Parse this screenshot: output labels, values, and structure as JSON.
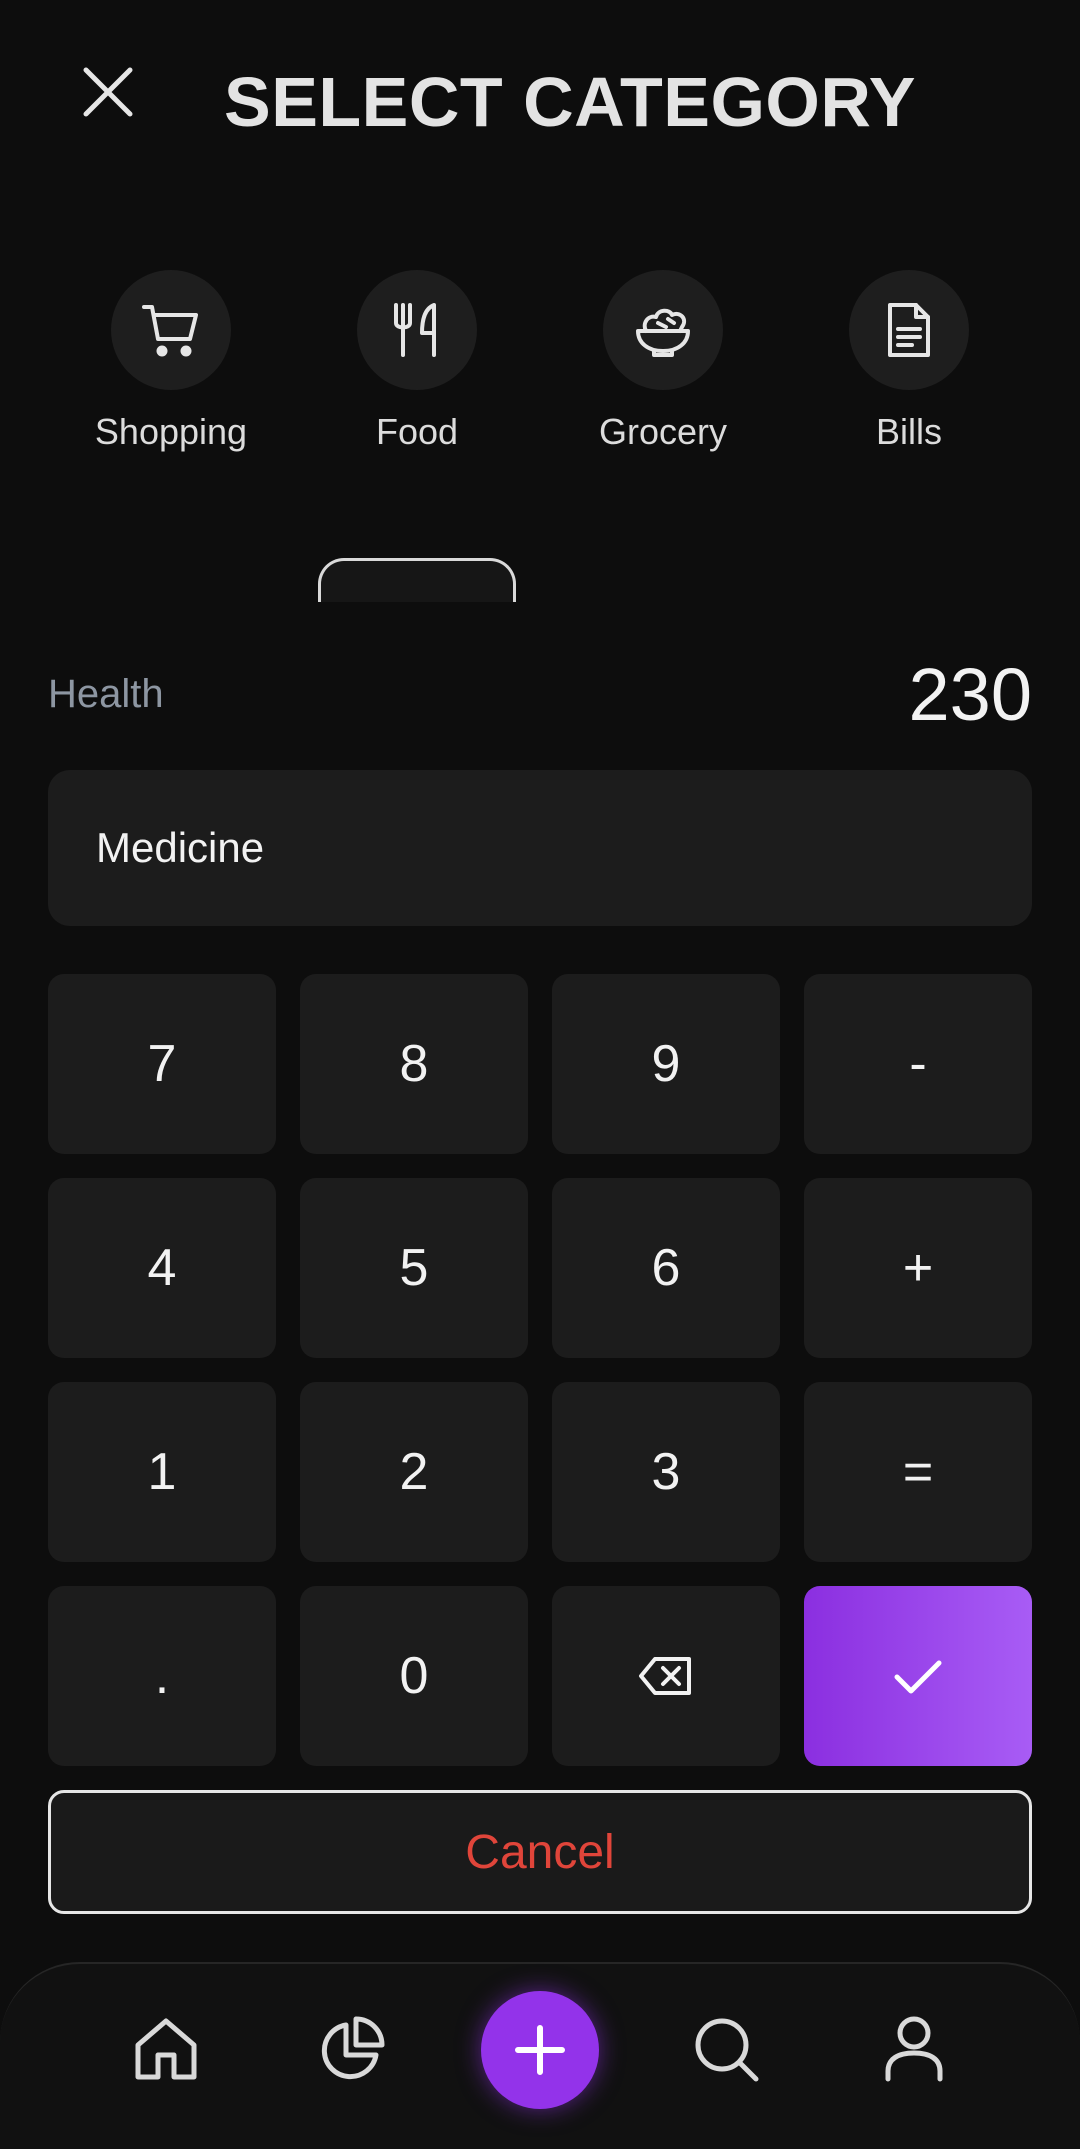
{
  "header": {
    "title": "SELECT CATEGORY",
    "close_icon": "close-icon"
  },
  "categories": [
    {
      "label": "Shopping",
      "icon": "shopping-cart-icon"
    },
    {
      "label": "Food",
      "icon": "fork-knife-icon"
    },
    {
      "label": "Grocery",
      "icon": "bowl-icon"
    },
    {
      "label": "Bills",
      "icon": "document-icon"
    }
  ],
  "entry": {
    "category": "Health",
    "amount": "230",
    "note_value": "Medicine"
  },
  "keypad": {
    "rows": [
      [
        "7",
        "8",
        "9",
        "-"
      ],
      [
        "4",
        "5",
        "6",
        "+"
      ],
      [
        "1",
        "2",
        "3",
        "="
      ],
      [
        ".",
        "0",
        "backspace-icon",
        "check-icon"
      ]
    ]
  },
  "actions": {
    "cancel_label": "Cancel"
  },
  "bottom_nav": {
    "items": [
      "home-icon",
      "pie-chart-icon",
      "plus-icon",
      "search-icon",
      "user-icon"
    ]
  },
  "colors": {
    "accent": "#9333ea",
    "accent_light": "#a85cf5",
    "danger": "#e0453a",
    "background": "#0d0d0d",
    "surface": "#1c1c1c"
  }
}
